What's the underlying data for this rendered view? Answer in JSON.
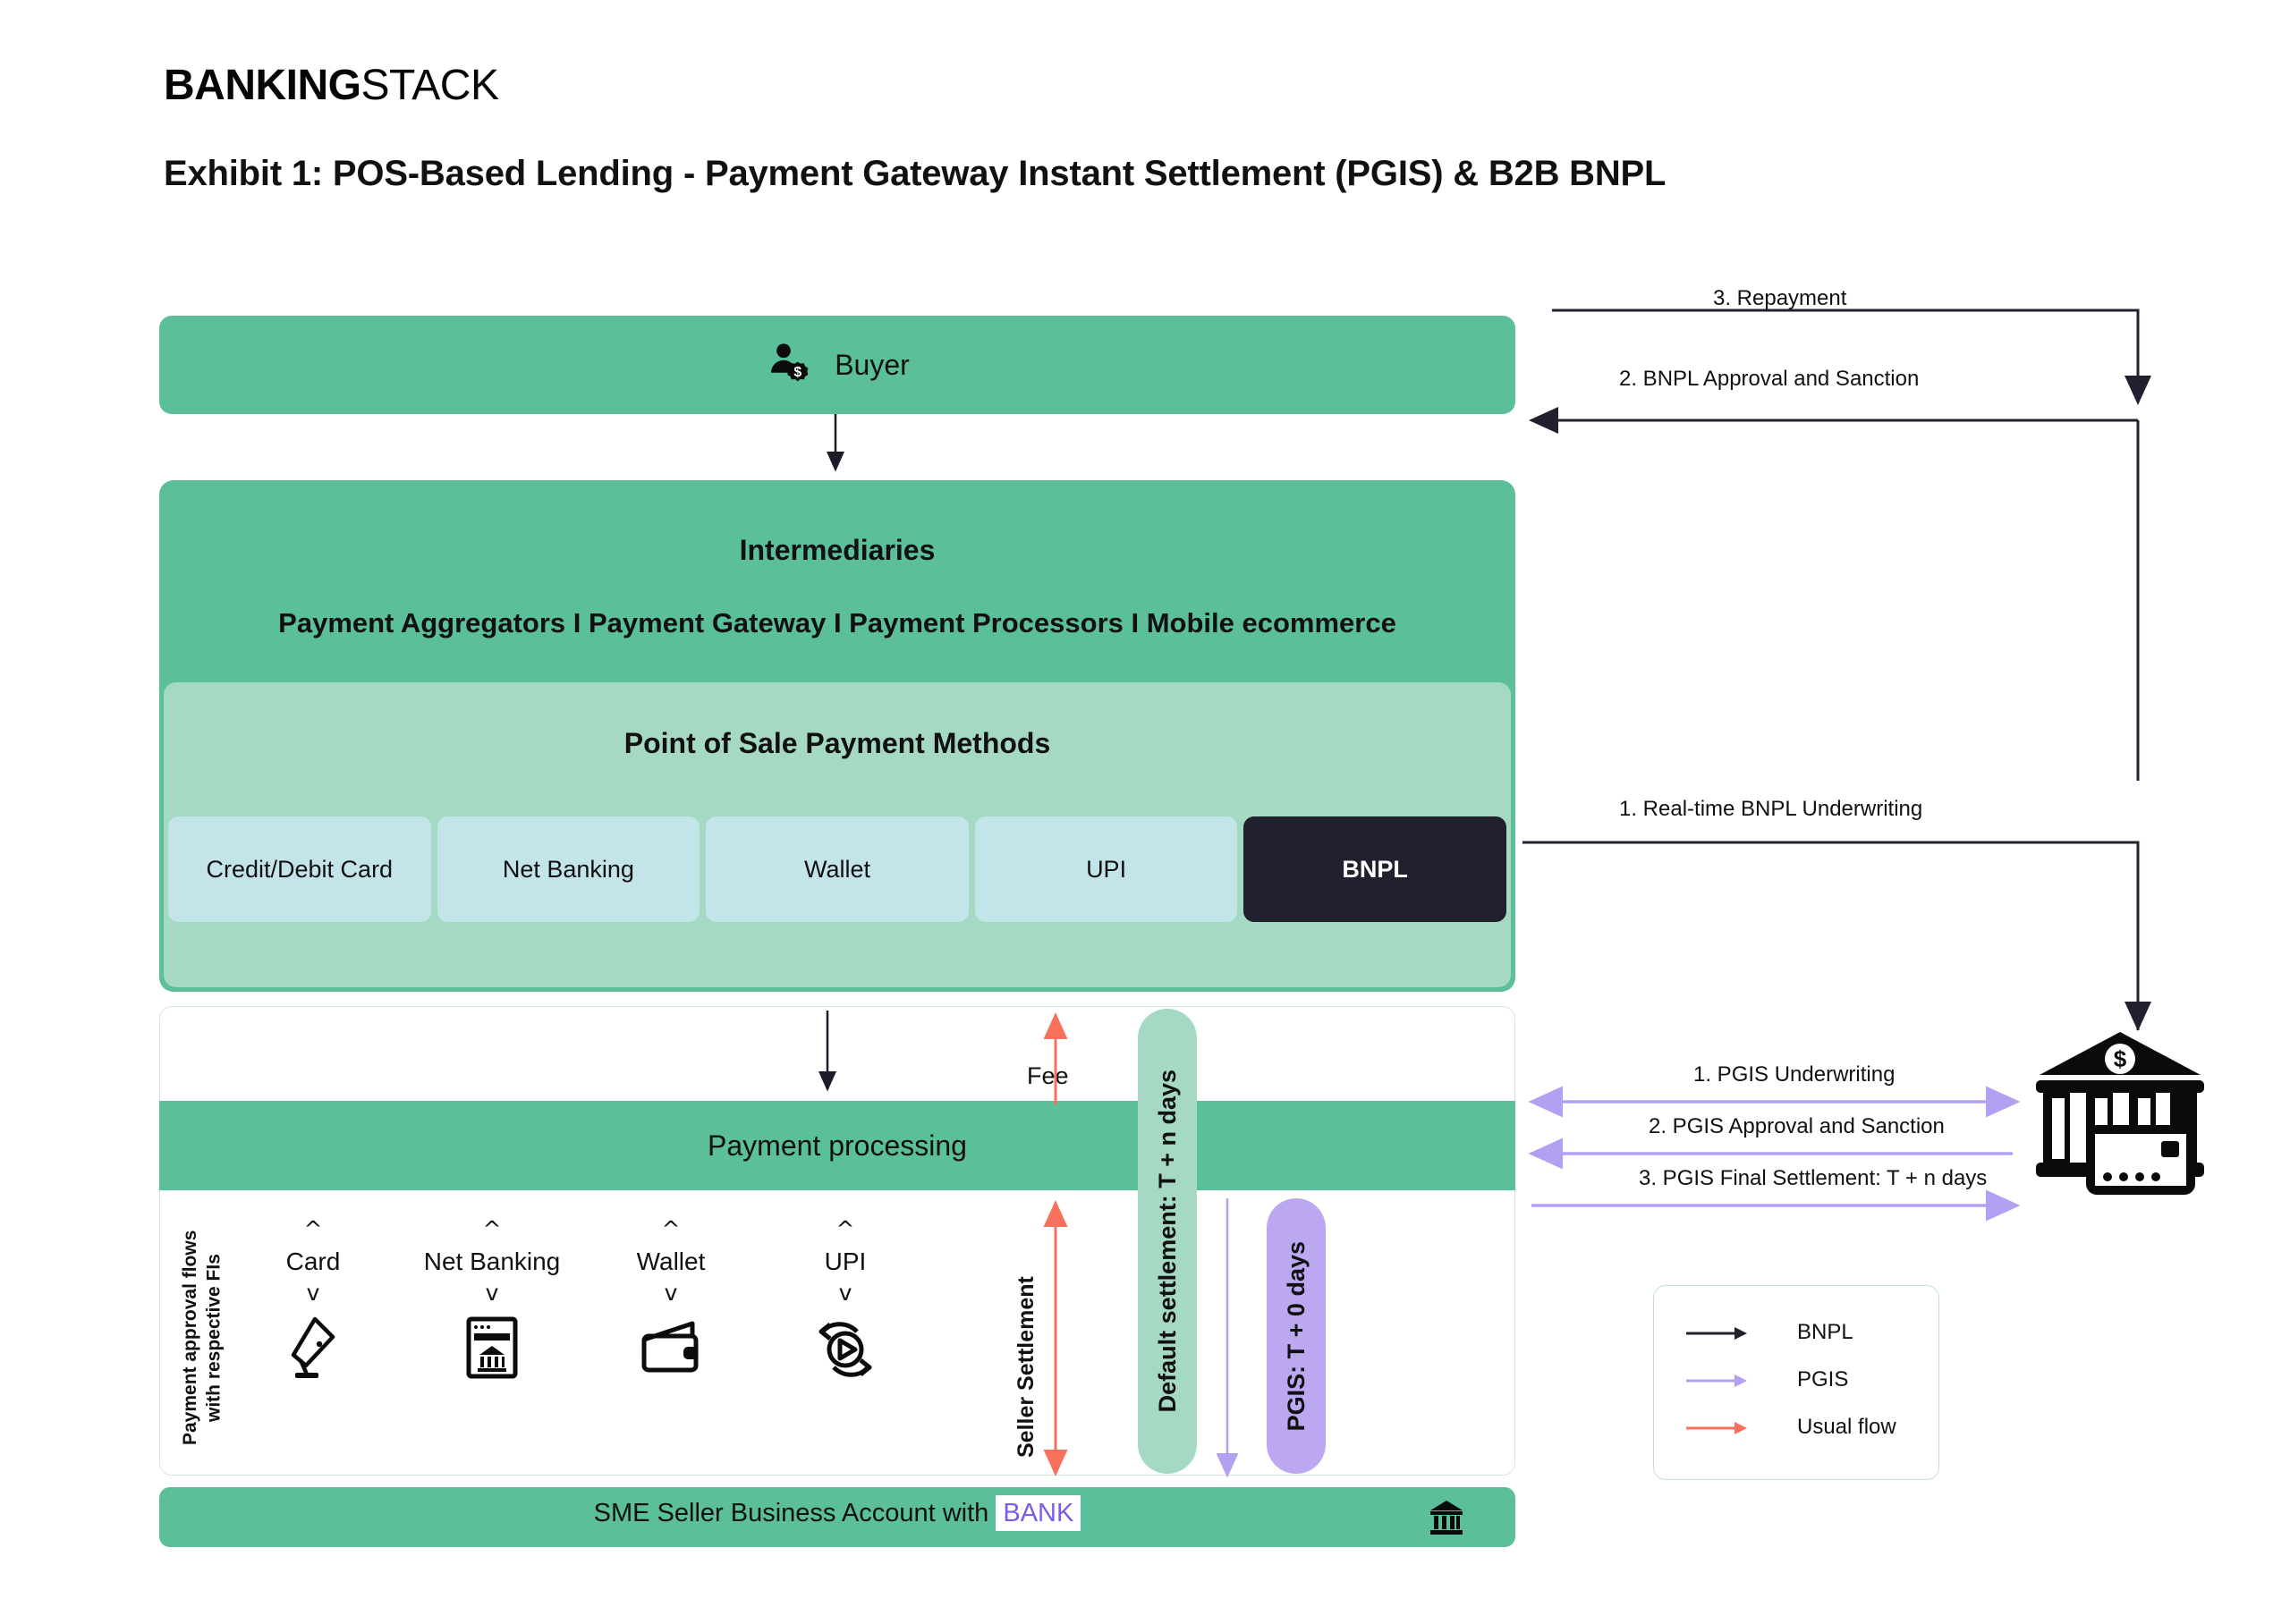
{
  "brand": {
    "bold": "BANKING",
    "light": "STACK"
  },
  "title": "Exhibit 1: POS-Based Lending - Payment Gateway Instant Settlement (PGIS) & B2B BNPL",
  "buyer": {
    "label": "Buyer",
    "icon": "buyer-person-dollar-icon"
  },
  "intermediaries": {
    "title": "Intermediaries",
    "subtitle": "Payment Aggregators I Payment Gateway I Payment Processors I Mobile ecommerce"
  },
  "pos": {
    "title": "Point of Sale Payment Methods",
    "methods": [
      {
        "label": "Credit/Debit Card",
        "style": "light-blue"
      },
      {
        "label": "Net Banking",
        "style": "light-blue"
      },
      {
        "label": "Wallet",
        "style": "light-blue"
      },
      {
        "label": "UPI",
        "style": "light-blue"
      },
      {
        "label": "BNPL",
        "style": "dark"
      }
    ]
  },
  "processing": {
    "title": "Payment processing",
    "approval_flows_label": "Payment approval flows\nwith respective FIs",
    "fee_label": "Fee",
    "seller_settlement_label": "Seller Settlement",
    "methods": [
      {
        "label": "Card",
        "icon": "credit-card-swipe-icon"
      },
      {
        "label": "Net Banking",
        "icon": "bank-browser-window-icon"
      },
      {
        "label": "Wallet",
        "icon": "wallet-icon"
      },
      {
        "label": "UPI",
        "icon": "upi-exchange-arrows-icon"
      }
    ],
    "default_settlement": "Default settlement: T + n days",
    "pgis_settlement": "PGIS: T + 0 days"
  },
  "sme": {
    "prefix": "SME Seller Business Account with ",
    "bank_word": "BANK",
    "icon": "bank-building-icon"
  },
  "bnpl_flows": [
    {
      "id": "repayment",
      "label": "3. Repayment"
    },
    {
      "id": "bnpl-approval",
      "label": "2. BNPL Approval and Sanction"
    },
    {
      "id": "bnpl-underwriting",
      "label": "1. Real-time BNPL Underwriting"
    }
  ],
  "pgis_flows": [
    {
      "id": "pgis-underwriting",
      "label": "1. PGIS Underwriting"
    },
    {
      "id": "pgis-approval",
      "label": "2. PGIS Approval and Sanction"
    },
    {
      "id": "pgis-final",
      "label": "3. PGIS Final Settlement: T + n days"
    }
  ],
  "bank_node": {
    "icon": "bank-with-card-icon"
  },
  "legend": {
    "items": [
      {
        "label": "BNPL",
        "color": "#21202F"
      },
      {
        "label": "PGIS",
        "color": "#B3A0F0"
      },
      {
        "label": "Usual flow",
        "color": "#F8715C"
      }
    ]
  },
  "colors": {
    "green": "#5BBF99",
    "light_green": "#A6D9C3",
    "light_blue": "#C3E5EA",
    "dark": "#21202F",
    "purple": "#BCA8F0",
    "coral": "#F8715C",
    "bank_purple": "#7B5BE8"
  }
}
